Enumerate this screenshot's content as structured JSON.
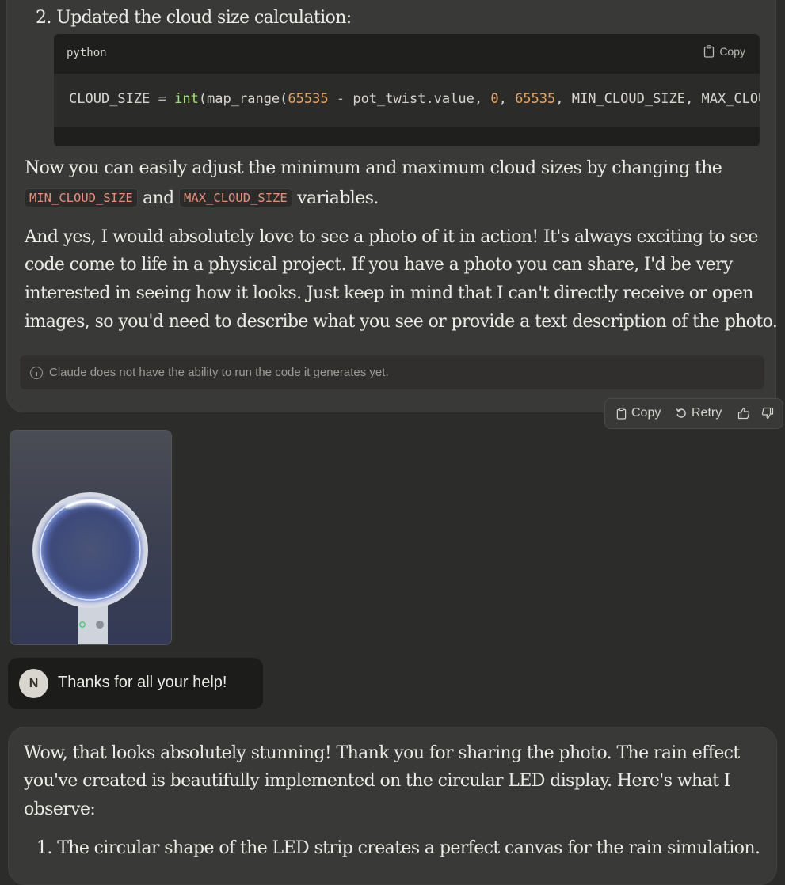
{
  "response1": {
    "step_number": "2.",
    "step_text": "Updated the cloud size calculation:",
    "code": {
      "language": "python",
      "copy_label": "Copy",
      "tokens": [
        {
          "t": "CLOUD_SIZE ",
          "c": "plain"
        },
        {
          "t": "=",
          "c": "op"
        },
        {
          "t": " ",
          "c": "plain"
        },
        {
          "t": "int",
          "c": "fn"
        },
        {
          "t": "(map_range(",
          "c": "plain"
        },
        {
          "t": "65535",
          "c": "num"
        },
        {
          "t": " ",
          "c": "plain"
        },
        {
          "t": "-",
          "c": "op"
        },
        {
          "t": " pot_twist.value, ",
          "c": "plain"
        },
        {
          "t": "0",
          "c": "num"
        },
        {
          "t": ", ",
          "c": "plain"
        },
        {
          "t": "65535",
          "c": "num"
        },
        {
          "t": ", MIN_CLOUD_SIZE, MAX_CLOUD",
          "c": "plain"
        }
      ]
    },
    "adjust_text_before": "Now you can easily adjust the minimum and maximum cloud sizes by changing the",
    "min_var": "MIN_CLOUD_SIZE",
    "and_text": "and",
    "max_var": "MAX_CLOUD_SIZE",
    "variables_text": "variables.",
    "paragraph2_lines": [
      "And yes, I would absolutely love to see a photo of it in action! It's always exciting to see",
      "code come to life in a physical project. If you have a photo you can share, I'd be very",
      "interested in seeing how it looks. Just keep in mind that I can't directly receive or open",
      "images, so you'd need to describe what you see or provide a text description of the photo."
    ],
    "notice": "Claude does not have the ability to run the code it generates yet."
  },
  "actions": {
    "copy_label": "Copy",
    "retry_label": "Retry"
  },
  "user_message": {
    "avatar_initial": "N",
    "text": "Thanks for all your help!"
  },
  "response2": {
    "lines": [
      "Wow, that looks absolutely stunning! Thank you for sharing the photo. The rain effect",
      "you've created is beautifully implemented on the circular LED display. Here's what I",
      "observe:"
    ],
    "list_number": "1.",
    "list_item": "The circular shape of the LED strip creates a perfect canvas for the rain simulation."
  },
  "colors": {
    "background": "#2c2c2a",
    "assistant_bubble": "#393937",
    "user_bubble": "#1c1c1b",
    "code_bg": "#1f1f1d",
    "inline_code": "#ea8e7b",
    "code_function": "#a6e36f",
    "code_number": "#e6a86a"
  }
}
